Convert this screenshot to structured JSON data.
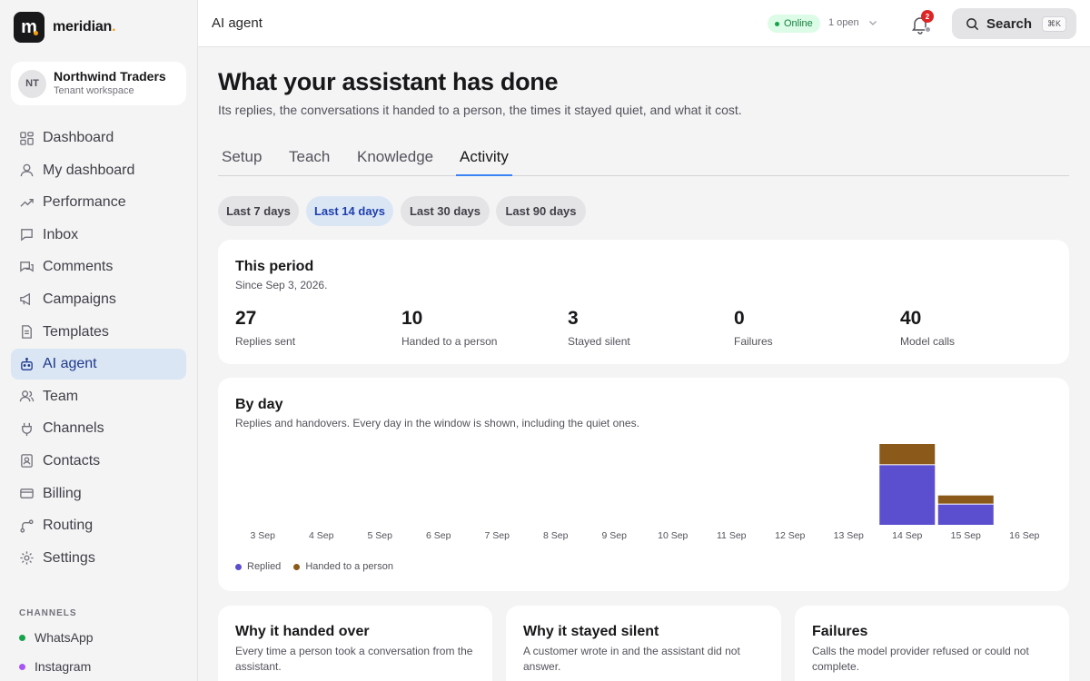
{
  "brand": {
    "logo_letter": "m",
    "name": "meridian",
    "accent": "#f59e0b"
  },
  "tenant": {
    "initials": "NT",
    "name": "Northwind Traders",
    "subtitle": "Tenant workspace"
  },
  "sidebar": {
    "items": [
      {
        "label": "Dashboard",
        "icon": "grid-icon"
      },
      {
        "label": "My dashboard",
        "icon": "user-icon"
      },
      {
        "label": "Performance",
        "icon": "trend-icon"
      },
      {
        "label": "Inbox",
        "icon": "chat-icon"
      },
      {
        "label": "Comments",
        "icon": "comments-icon"
      },
      {
        "label": "Campaigns",
        "icon": "megaphone-icon"
      },
      {
        "label": "Templates",
        "icon": "document-icon"
      },
      {
        "label": "AI agent",
        "icon": "robot-icon",
        "active": true
      },
      {
        "label": "Team",
        "icon": "team-icon"
      },
      {
        "label": "Channels",
        "icon": "plug-icon"
      },
      {
        "label": "Contacts",
        "icon": "contact-icon"
      },
      {
        "label": "Billing",
        "icon": "card-icon"
      },
      {
        "label": "Routing",
        "icon": "route-icon"
      },
      {
        "label": "Settings",
        "icon": "gear-icon"
      }
    ],
    "channels_heading": "CHANNELS",
    "channels": [
      {
        "label": "WhatsApp",
        "color": "#16a34a"
      },
      {
        "label": "Instagram",
        "color": "#a855f7"
      }
    ]
  },
  "topbar": {
    "title": "AI agent",
    "status": "Online",
    "open_count": "1 open",
    "notifications": "2",
    "search_label": "Search",
    "search_shortcut": "⌘K"
  },
  "main": {
    "title": "What your assistant has done",
    "subtitle": "Its replies, the conversations it handed to a person, the times it stayed quiet, and what it cost.",
    "tabs": [
      "Setup",
      "Teach",
      "Knowledge",
      "Activity"
    ],
    "active_tab": "Activity",
    "ranges": [
      "Last 7 days",
      "Last 14 days",
      "Last 30 days",
      "Last 90 days"
    ],
    "active_range": "Last 14 days",
    "period": {
      "title": "This period",
      "subtitle": "Since Sep 3, 2026.",
      "stats": [
        {
          "value": "27",
          "label": "Replies sent"
        },
        {
          "value": "10",
          "label": "Handed to a person"
        },
        {
          "value": "3",
          "label": "Stayed silent"
        },
        {
          "value": "0",
          "label": "Failures"
        },
        {
          "value": "40",
          "label": "Model calls"
        }
      ]
    },
    "by_day": {
      "title": "By day",
      "subtitle": "Replies and handovers. Every day in the window is shown, including the quiet ones."
    },
    "cards": [
      {
        "title": "Why it handed over",
        "text": "Every time a person took a conversation from the assistant."
      },
      {
        "title": "Why it stayed silent",
        "text": "A customer wrote in and the assistant did not answer."
      },
      {
        "title": "Failures",
        "text": "Calls the model provider refused or could not complete."
      }
    ]
  },
  "chart_data": {
    "type": "bar",
    "stacked": true,
    "categories": [
      "3 Sep",
      "4 Sep",
      "5 Sep",
      "6 Sep",
      "7 Sep",
      "8 Sep",
      "9 Sep",
      "10 Sep",
      "11 Sep",
      "12 Sep",
      "13 Sep",
      "14 Sep",
      "15 Sep",
      "16 Sep"
    ],
    "series": [
      {
        "name": "Replied",
        "color": "#5b4fcf",
        "values": [
          0,
          0,
          0,
          0,
          0,
          0,
          0,
          0,
          0,
          0,
          0,
          20,
          7,
          0
        ]
      },
      {
        "name": "Handed to a person",
        "color": "#8b5a1b",
        "values": [
          0,
          0,
          0,
          0,
          0,
          0,
          0,
          0,
          0,
          0,
          0,
          7,
          3,
          0
        ]
      }
    ],
    "title": "By day",
    "grid": false,
    "legend": "bottom-left"
  }
}
